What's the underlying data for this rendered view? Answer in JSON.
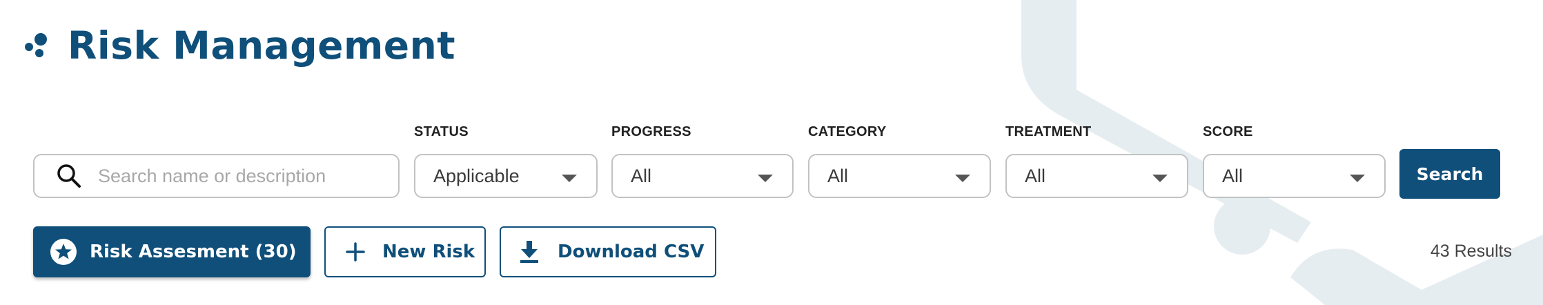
{
  "header": {
    "title": "Risk Management",
    "logo_icon": "dots-logo-icon"
  },
  "search": {
    "placeholder": "Search name or description",
    "value": "",
    "icon": "search-icon"
  },
  "filters": [
    {
      "label": "STATUS",
      "value": "Applicable"
    },
    {
      "label": "PROGRESS",
      "value": "All"
    },
    {
      "label": "CATEGORY",
      "value": "All"
    },
    {
      "label": "TREATMENT",
      "value": "All"
    },
    {
      "label": "SCORE",
      "value": "All"
    }
  ],
  "search_button": {
    "label": "Search"
  },
  "actions": {
    "risk_assessment": {
      "label": "Risk Assesment (30)",
      "icon": "star-circle-icon"
    },
    "new_risk": {
      "label": "New Risk",
      "icon": "plus-icon"
    },
    "download_csv": {
      "label": "Download CSV",
      "icon": "download-icon"
    }
  },
  "results": {
    "text": "43 Results"
  },
  "colors": {
    "primary": "#0f4f7a",
    "decoration": "#e6edf1",
    "border": "#c2c2c2"
  }
}
